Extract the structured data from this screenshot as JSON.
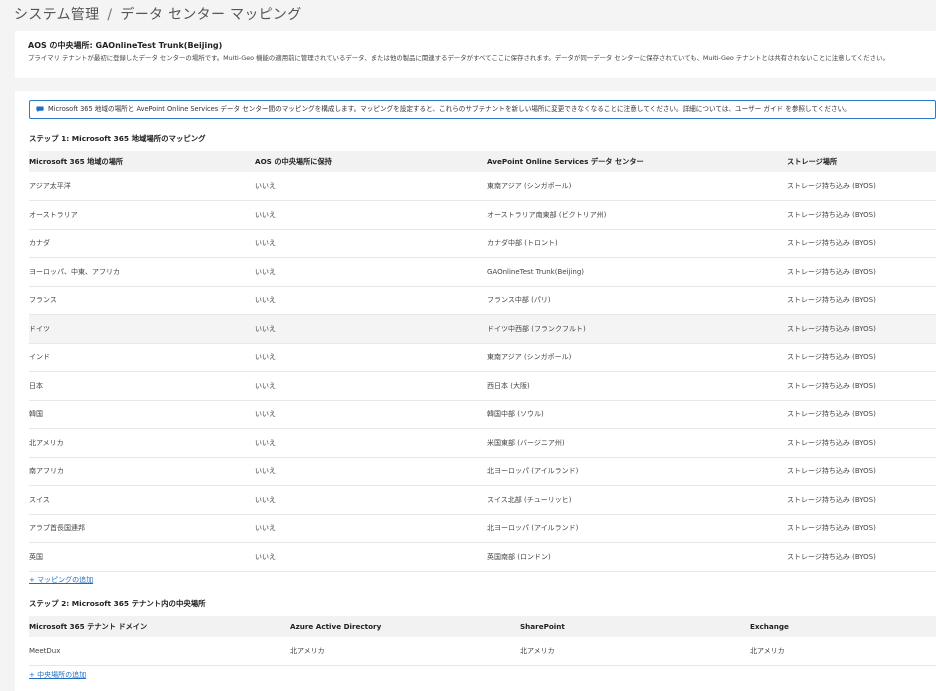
{
  "breadcrumb": {
    "root": "システム管理",
    "separator": "/",
    "current": "データ センター マッピング"
  },
  "info": {
    "title": "AOS の中央場所: GAOnlineTest Trunk(Beijing)",
    "description": "プライマリ テナントが最初に登録したデータ センターの場所です。Multi-Geo 機能の適用前に管理されているデータ、または他の製品に関連するデータがすべてここに保存されます。データが同一データ センターに保存されていても、Multi-Geo テナントとは共有されないことに注意してください。"
  },
  "notice": {
    "icon": "chat-bubble-icon",
    "text": "Microsoft 365 地域の場所と AvePoint Online Services データ センター間のマッピングを構成します。マッピングを設定すると、これらのサブテナントを新しい場所に変更できなくなることに注意してください。詳細については、ユーザー ガイド を参照してください。"
  },
  "step1": {
    "title": "ステップ 1: Microsoft 365 地域場所のマッピング",
    "columns": [
      "Microsoft 365 地域の場所",
      "AOS の中央場所に保持",
      "AvePoint Online Services データ センター",
      "ストレージ場所"
    ],
    "rows": [
      [
        "アジア太平洋",
        "いいえ",
        "東南アジア (シンガポール)",
        "ストレージ持ち込み (BYOS)"
      ],
      [
        "オーストラリア",
        "いいえ",
        "オーストラリア南東部 (ビクトリア州)",
        "ストレージ持ち込み (BYOS)"
      ],
      [
        "カナダ",
        "いいえ",
        "カナダ中部 (トロント)",
        "ストレージ持ち込み (BYOS)"
      ],
      [
        "ヨーロッパ、中東、アフリカ",
        "いいえ",
        "GAOnlineTest Trunk(Beijing)",
        "ストレージ持ち込み (BYOS)"
      ],
      [
        "フランス",
        "いいえ",
        "フランス中部 (パリ)",
        "ストレージ持ち込み (BYOS)"
      ],
      [
        "ドイツ",
        "いいえ",
        "ドイツ中西部 (フランクフルト)",
        "ストレージ持ち込み (BYOS)"
      ],
      [
        "インド",
        "いいえ",
        "東南アジア (シンガポール)",
        "ストレージ持ち込み (BYOS)"
      ],
      [
        "日本",
        "いいえ",
        "西日本 (大阪)",
        "ストレージ持ち込み (BYOS)"
      ],
      [
        "韓国",
        "いいえ",
        "韓国中部 (ソウル)",
        "ストレージ持ち込み (BYOS)"
      ],
      [
        "北アメリカ",
        "いいえ",
        "米国東部 (バージニア州)",
        "ストレージ持ち込み (BYOS)"
      ],
      [
        "南アフリカ",
        "いいえ",
        "北ヨーロッパ (アイルランド)",
        "ストレージ持ち込み (BYOS)"
      ],
      [
        "スイス",
        "いいえ",
        "スイス北部 (チューリッヒ)",
        "ストレージ持ち込み (BYOS)"
      ],
      [
        "アラブ首長国連邦",
        "いいえ",
        "北ヨーロッパ (アイルランド)",
        "ストレージ持ち込み (BYOS)"
      ],
      [
        "英国",
        "いいえ",
        "英国南部 (ロンドン)",
        "ストレージ持ち込み (BYOS)"
      ]
    ],
    "add_link": "+ マッピングの追加"
  },
  "step2": {
    "title": "ステップ 2: Microsoft 365 テナント内の中央場所",
    "columns": [
      "Microsoft 365 テナント ドメイン",
      "Azure Active Directory",
      "SharePoint",
      "Exchange"
    ],
    "rows": [
      [
        "MeetDux",
        "北アメリカ",
        "北アメリカ",
        "北アメリカ"
      ]
    ],
    "add_link": "+ 中央場所の追加"
  }
}
